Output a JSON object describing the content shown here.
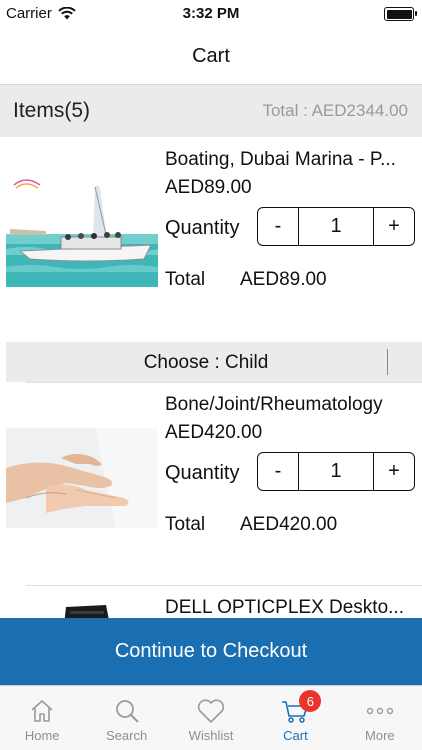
{
  "status_bar": {
    "carrier": "Carrier",
    "time": "3:32 PM"
  },
  "nav": {
    "title": "Cart"
  },
  "summary": {
    "items_label": "Items(5)",
    "total_label": "Total : AED2344.00"
  },
  "items": [
    {
      "name": "Boating, Dubai Marina - P...",
      "price": "AED89.00",
      "quantity_label": "Quantity",
      "minus": "-",
      "quantity": "1",
      "plus": "+",
      "total_label": "Total",
      "total_value": "AED89.00",
      "image": "boat-image"
    },
    {
      "name": "Bone/Joint/Rheumatology",
      "price": "AED420.00",
      "quantity_label": "Quantity",
      "minus": "-",
      "quantity": "1",
      "plus": "+",
      "total_label": "Total",
      "total_value": "AED420.00",
      "image": "hands-image"
    },
    {
      "name": "DELL OPTICPLEX Deskto...",
      "image": "desktop-image"
    }
  ],
  "choose": {
    "label": "Choose : Child"
  },
  "checkout": {
    "label": "Continue to Checkout"
  },
  "tabs": [
    {
      "label": "Home",
      "icon": "home-icon"
    },
    {
      "label": "Search",
      "icon": "search-icon"
    },
    {
      "label": "Wishlist",
      "icon": "heart-icon"
    },
    {
      "label": "Cart",
      "icon": "cart-icon",
      "badge": "6",
      "active": true
    },
    {
      "label": "More",
      "icon": "more-icon"
    }
  ],
  "colors": {
    "accent": "#1a6fb3",
    "badge": "#e8362c",
    "section_bg": "#ebebeb"
  }
}
